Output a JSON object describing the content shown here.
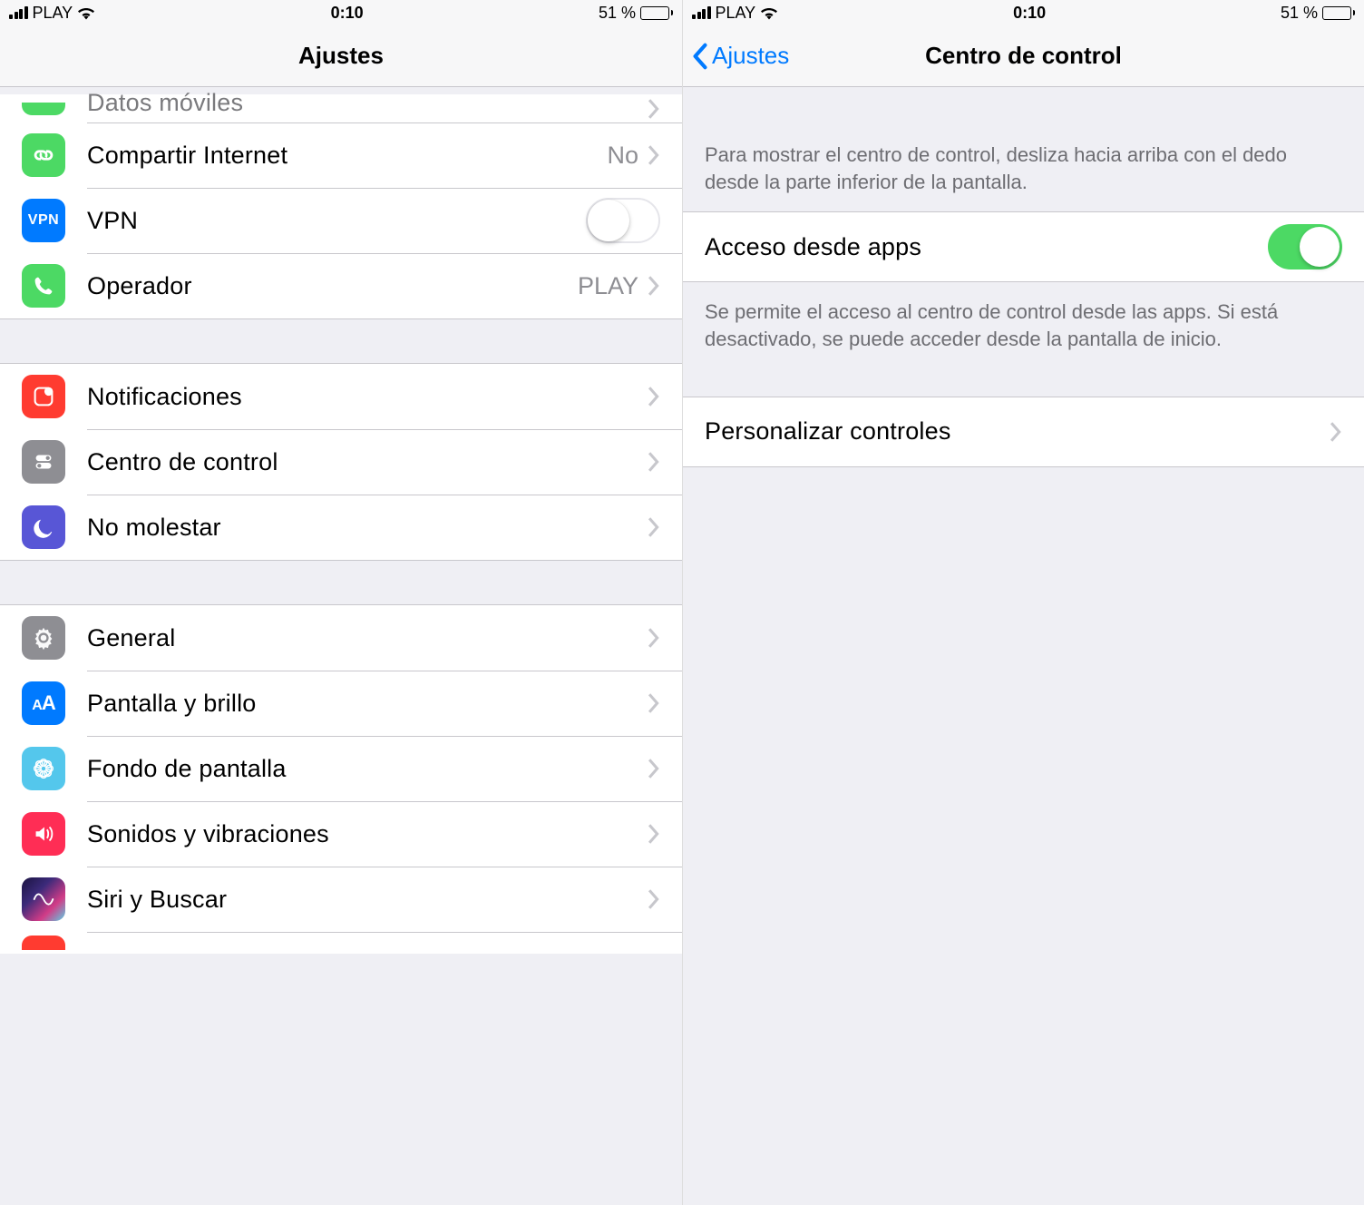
{
  "status": {
    "carrier": "PLAY",
    "time": "0:10",
    "battery_text": "51 %"
  },
  "left": {
    "title": "Ajustes",
    "rows": {
      "datos": "Datos móviles",
      "compartir_label": "Compartir Internet",
      "compartir_value": "No",
      "vpn_label": "VPN",
      "operador_label": "Operador",
      "operador_value": "PLAY",
      "notif": "Notificaciones",
      "centro": "Centro de control",
      "no_molestar": "No molestar",
      "general": "General",
      "pantalla": "Pantalla y brillo",
      "fondo": "Fondo de pantalla",
      "sonidos": "Sonidos y vibraciones",
      "siri": "Siri y Buscar"
    },
    "vpn_icon_text": "VPN",
    "display_icon_text": "AA"
  },
  "right": {
    "back": "Ajustes",
    "title": "Centro de control",
    "explain1": "Para mostrar el centro de control, desliza hacia arriba con el dedo desde la parte inferior de la pantalla.",
    "acceso_label": "Acceso desde apps",
    "explain2": "Se permite el acceso al centro de control desde las apps. Si está desactivado, se puede acceder desde la pantalla de inicio.",
    "personalizar": "Personalizar controles"
  }
}
